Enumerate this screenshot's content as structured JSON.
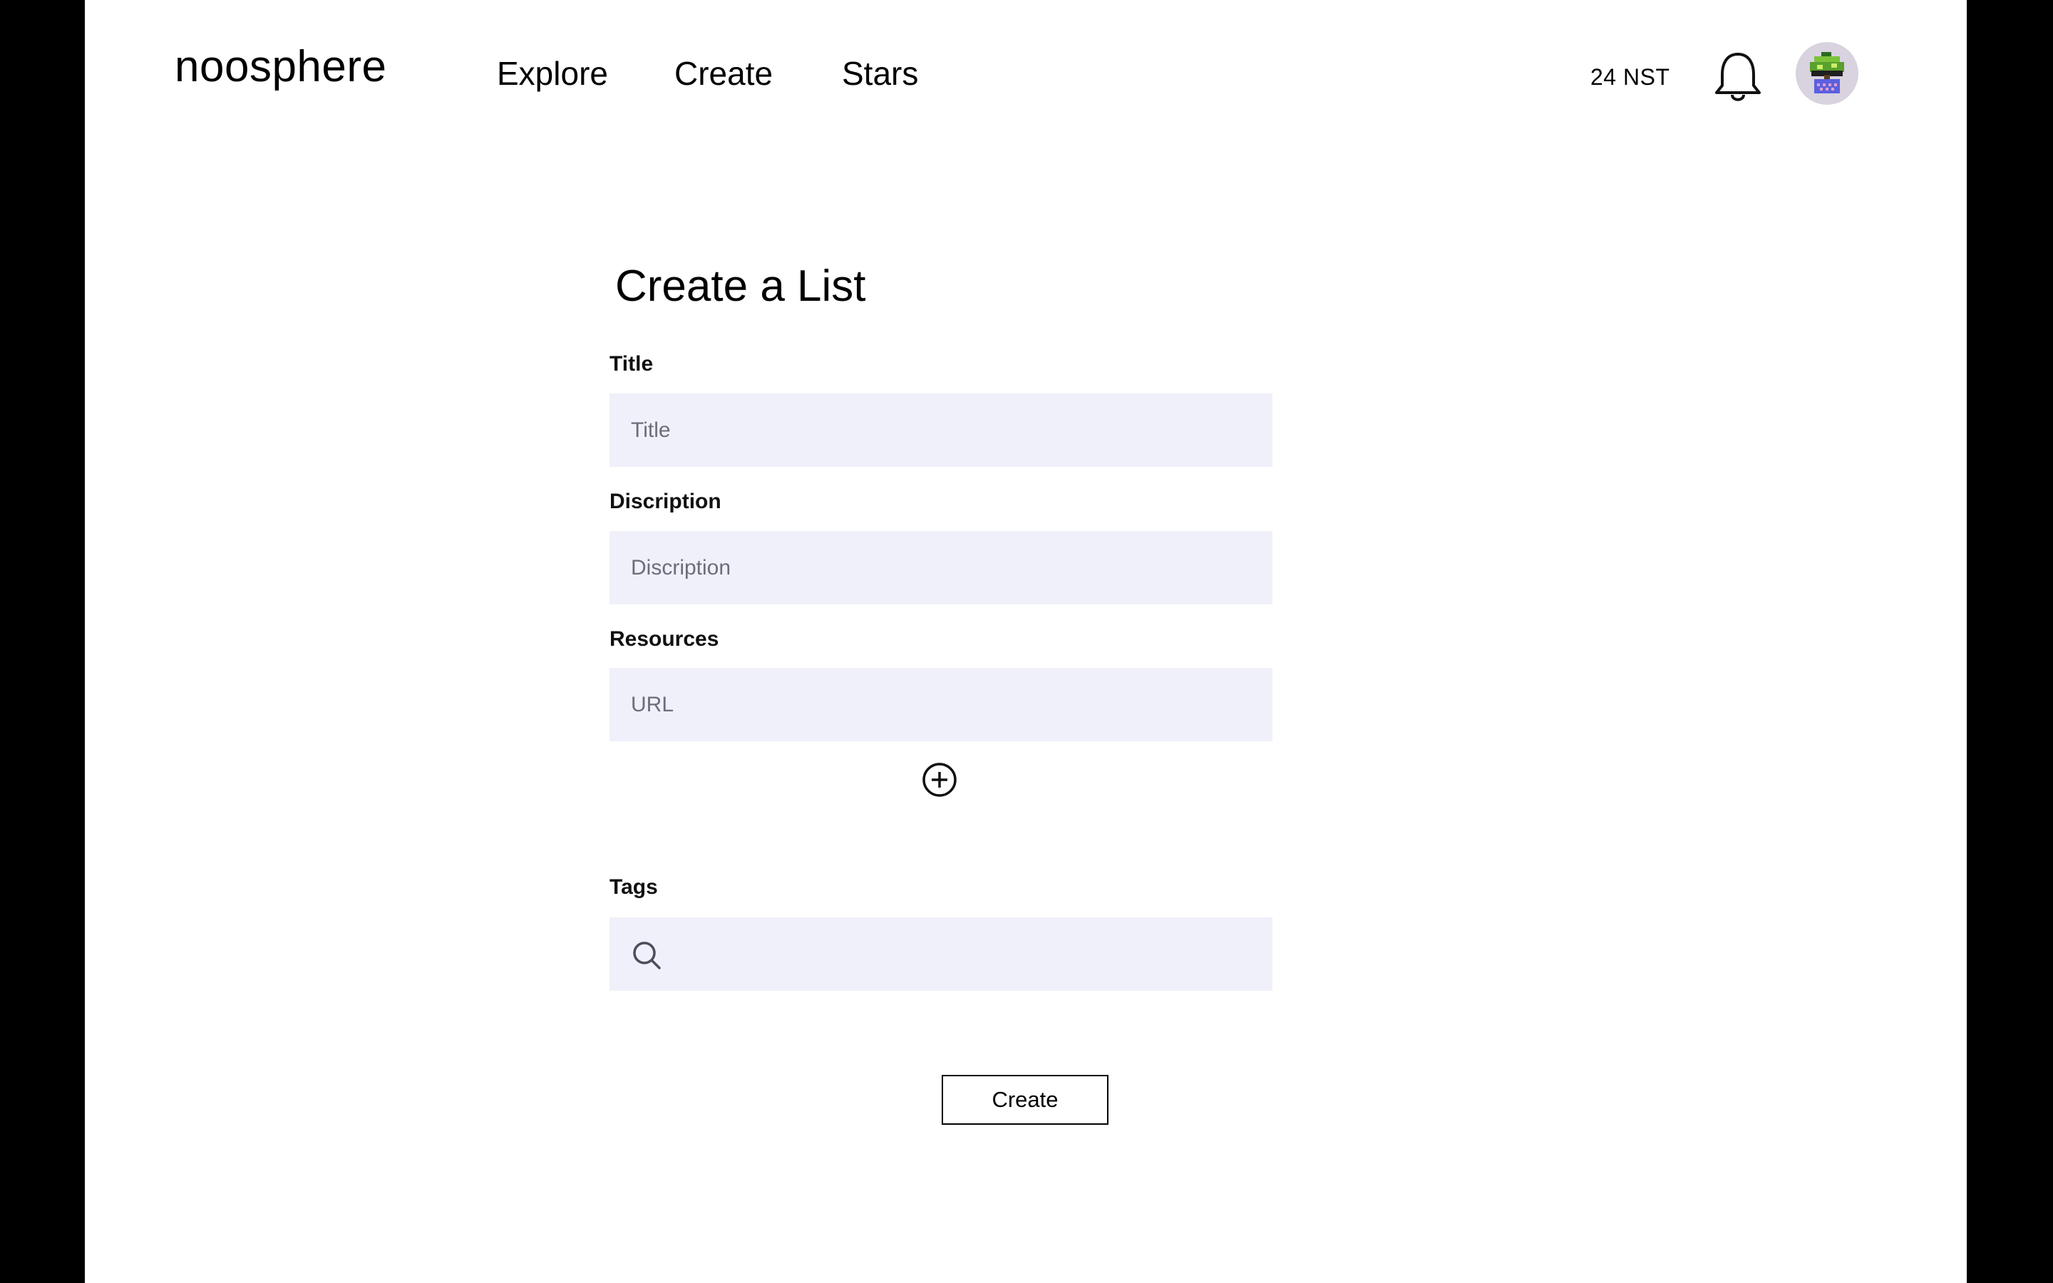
{
  "header": {
    "brand": "noosphere",
    "nav": [
      {
        "label": "Explore"
      },
      {
        "label": "Create"
      },
      {
        "label": "Stars"
      }
    ],
    "balance": "24 NST"
  },
  "form": {
    "title": "Create a List",
    "fields": {
      "title": {
        "label": "Title",
        "placeholder": "Title",
        "value": ""
      },
      "description": {
        "label": "Discription",
        "placeholder": "Discription",
        "value": ""
      },
      "resources": {
        "label": "Resources",
        "placeholder": "URL",
        "value": ""
      },
      "tags": {
        "label": "Tags",
        "value": ""
      }
    },
    "submit_label": "Create"
  },
  "icons": {
    "notifications": "bell-icon",
    "add_resource": "plus-circle-icon",
    "tag_search": "search-icon",
    "profile": "avatar"
  },
  "colors": {
    "input_background": "#eff0f9",
    "page_background": "#ffffff",
    "frame": "#000000"
  }
}
